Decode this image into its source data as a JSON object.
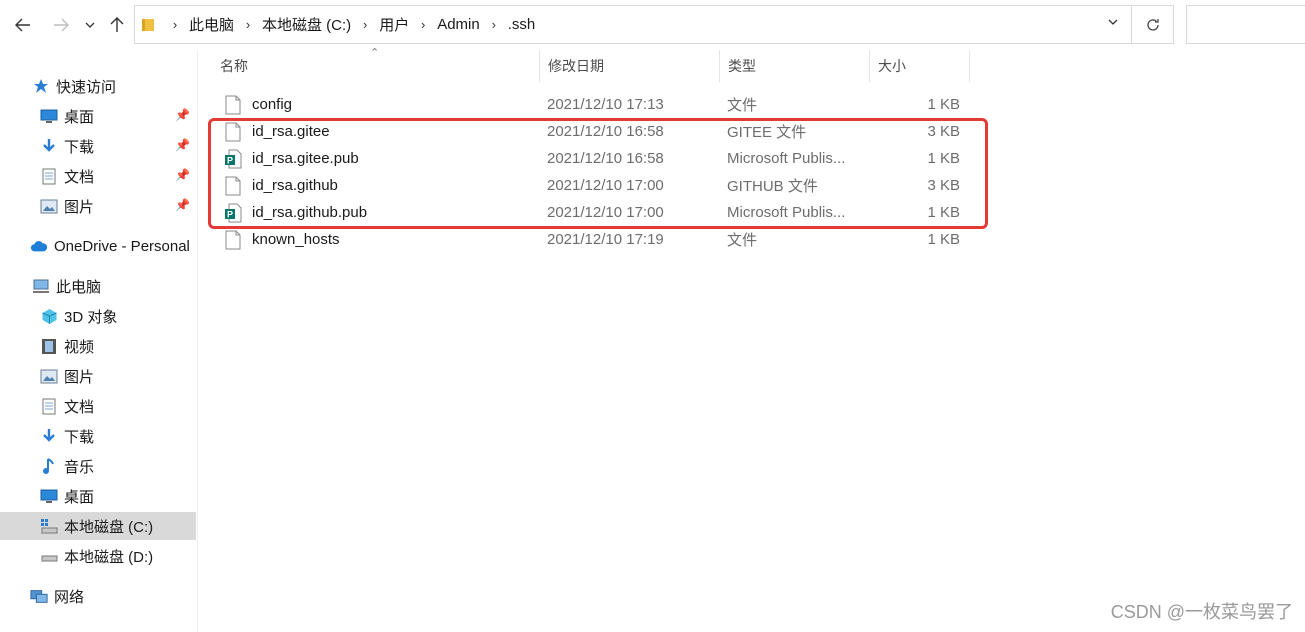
{
  "nav": {
    "back_icon": "arrow-left-icon",
    "forward_icon": "arrow-right-icon",
    "recent_icon": "chevron-down-icon",
    "up_icon": "arrow-up-icon",
    "refresh_icon": "refresh-icon"
  },
  "breadcrumb": [
    "此电脑",
    "本地磁盘 (C:)",
    "用户",
    "Admin",
    ".ssh"
  ],
  "sidebar": {
    "items": [
      {
        "label": "快速访问",
        "icon": "star-icon",
        "level": 0
      },
      {
        "label": "桌面",
        "icon": "desktop-icon",
        "level": 1,
        "pinned": true
      },
      {
        "label": "下载",
        "icon": "download-icon",
        "level": 1,
        "pinned": true
      },
      {
        "label": "文档",
        "icon": "document-icon",
        "level": 1,
        "pinned": true
      },
      {
        "label": "图片",
        "icon": "pictures-icon",
        "level": 1,
        "pinned": true
      },
      {
        "label": "OneDrive - Personal",
        "icon": "cloud-icon",
        "level": 0
      },
      {
        "label": "此电脑",
        "icon": "computer-icon",
        "level": 0
      },
      {
        "label": "3D 对象",
        "icon": "cube-icon",
        "level": 1
      },
      {
        "label": "视频",
        "icon": "video-icon",
        "level": 1
      },
      {
        "label": "图片",
        "icon": "pictures-icon",
        "level": 1
      },
      {
        "label": "文档",
        "icon": "document-icon",
        "level": 1
      },
      {
        "label": "下载",
        "icon": "download-icon",
        "level": 1
      },
      {
        "label": "音乐",
        "icon": "music-icon",
        "level": 1
      },
      {
        "label": "桌面",
        "icon": "desktop-icon",
        "level": 1
      },
      {
        "label": "本地磁盘 (C:)",
        "icon": "drive-c-icon",
        "level": 1,
        "selected": true
      },
      {
        "label": "本地磁盘 (D:)",
        "icon": "drive-icon",
        "level": 1
      },
      {
        "label": "网络",
        "icon": "network-icon",
        "level": 0
      }
    ]
  },
  "columns": {
    "name": "名称",
    "date": "修改日期",
    "type": "类型",
    "size": "大小"
  },
  "files": [
    {
      "name": "config",
      "date": "2021/12/10 17:13",
      "type": "文件",
      "size": "1 KB",
      "icon": "file-icon"
    },
    {
      "name": "id_rsa.gitee",
      "date": "2021/12/10 16:58",
      "type": "GITEE 文件",
      "size": "3 KB",
      "icon": "file-icon"
    },
    {
      "name": "id_rsa.gitee.pub",
      "date": "2021/12/10 16:58",
      "type": "Microsoft Publis...",
      "size": "1 KB",
      "icon": "publisher-file-icon"
    },
    {
      "name": "id_rsa.github",
      "date": "2021/12/10 17:00",
      "type": "GITHUB 文件",
      "size": "3 KB",
      "icon": "file-icon"
    },
    {
      "name": "id_rsa.github.pub",
      "date": "2021/12/10 17:00",
      "type": "Microsoft Publis...",
      "size": "1 KB",
      "icon": "publisher-file-icon"
    },
    {
      "name": "known_hosts",
      "date": "2021/12/10 17:19",
      "type": "文件",
      "size": "1 KB",
      "icon": "file-icon"
    }
  ],
  "colors": {
    "highlight": "#e53935",
    "selected_bg": "#d9d9d9",
    "folder": "#f0c040"
  },
  "watermark": "CSDN @一枚菜鸟罢了"
}
